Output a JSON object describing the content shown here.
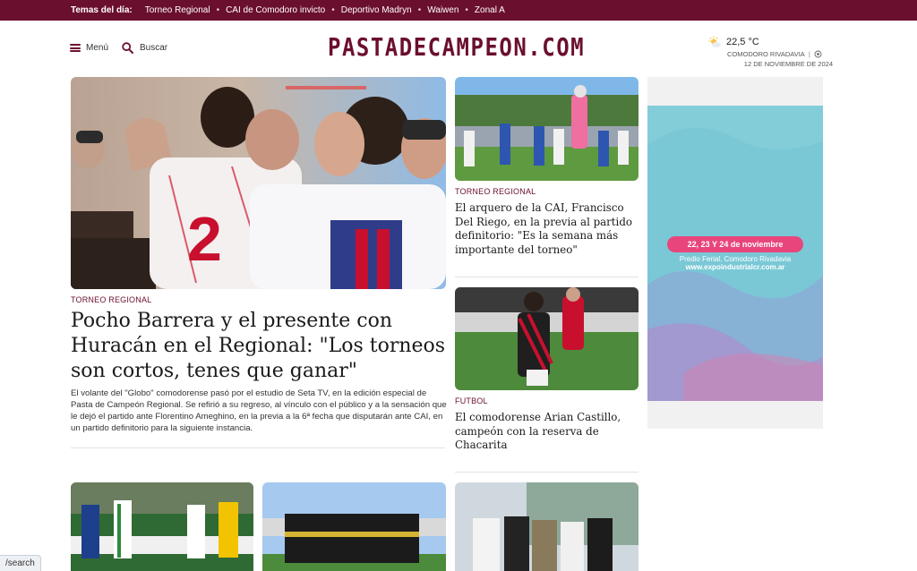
{
  "topbar": {
    "label": "Temas del día:",
    "topics": [
      "Torneo Regional",
      "CAI de Comodoro invicto",
      "Deportivo Madryn",
      "Waiwen",
      "Zonal A"
    ],
    "bg": "#6b0f2e"
  },
  "header": {
    "menu_label": "Menú",
    "search_label": "Buscar",
    "logo_text": "PASTADECAMPEON.COM",
    "weather": {
      "temperature": "22,5 °C",
      "city": "COMODORO RIVADAVIA",
      "date": "12 DE NOVIEMBRE DE 2024",
      "icon": "sun-cloud-icon"
    }
  },
  "feature": {
    "category": "TORNEO REGIONAL",
    "title": "Pocho Barrera y el presente con Huracán en el Regional: \"Los torneos son cortos, tenes que ganar\"",
    "summary": "El volante del \"Globo\" comodorense pasó por el estudio de Seta TV, en la edición especial de Pasta de Campeón Regional. Se refirió a su regreso, al vínculo con el público y a la sensación que le dejó el partido ante Florentino Ameghino, en la previa a la 6ª fecha que disputarán ante CAI, en un partido definitorio para la siguiente instancia."
  },
  "side_articles": [
    {
      "category": "TORNEO REGIONAL",
      "title": "El arquero de la CAI, Francisco Del Riego, en la previa al partido definitorio: \"Es la semana más importante del torneo\""
    },
    {
      "category": "FUTBOL",
      "title": "El comodorense Arian Castillo, campeón con la reserva de Chacarita"
    }
  ],
  "ad": {
    "dates": "22, 23 Y 24 de noviembre",
    "venue": "Predio Ferial. Comodoro Rivadavia",
    "url": "www.expoindustrialcr.com.ar"
  },
  "status_bar": {
    "text": "/search"
  },
  "colors": {
    "accent": "#6b0f2e",
    "ad_bg": "#79c6d3",
    "ad_pill": "#e8457c"
  }
}
